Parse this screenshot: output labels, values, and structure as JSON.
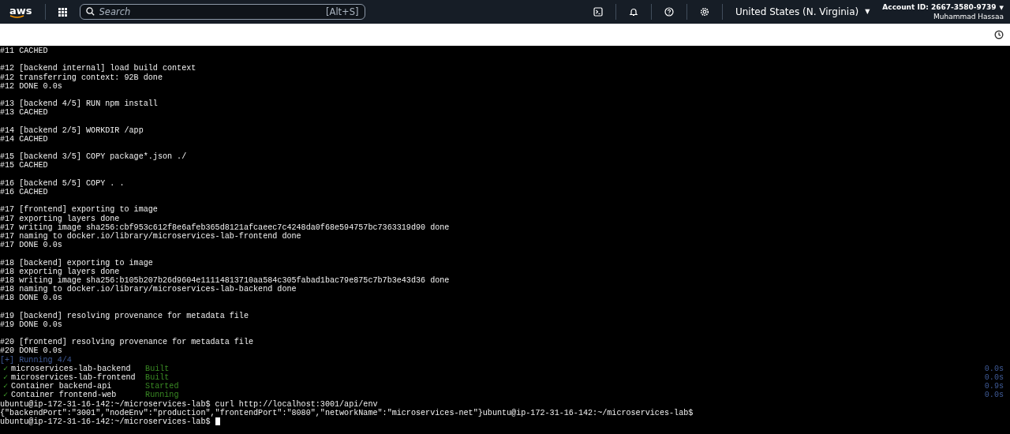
{
  "header": {
    "logo": "aws",
    "search": {
      "placeholder": "Search",
      "shortcut": "[Alt+S]"
    },
    "region": "United States (N. Virginia)",
    "region_caret": "▼",
    "account": "Account ID: 2667-3580-9739",
    "account_caret": "▼",
    "user": "Muhammad Hassaa"
  },
  "terminal": {
    "lines": [
      {
        "kind": "text",
        "text": "#11 CACHED"
      },
      {
        "kind": "blank"
      },
      {
        "kind": "text",
        "text": "#12 [backend internal] load build context"
      },
      {
        "kind": "text",
        "text": "#12 transferring context: 92B done"
      },
      {
        "kind": "text",
        "text": "#12 DONE 0.0s"
      },
      {
        "kind": "blank"
      },
      {
        "kind": "text",
        "text": "#13 [backend 4/5] RUN npm install"
      },
      {
        "kind": "text",
        "text": "#13 CACHED"
      },
      {
        "kind": "blank"
      },
      {
        "kind": "text",
        "text": "#14 [backend 2/5] WORKDIR /app"
      },
      {
        "kind": "text",
        "text": "#14 CACHED"
      },
      {
        "kind": "blank"
      },
      {
        "kind": "text",
        "text": "#15 [backend 3/5] COPY package*.json ./"
      },
      {
        "kind": "text",
        "text": "#15 CACHED"
      },
      {
        "kind": "blank"
      },
      {
        "kind": "text",
        "text": "#16 [backend 5/5] COPY . ."
      },
      {
        "kind": "text",
        "text": "#16 CACHED"
      },
      {
        "kind": "blank"
      },
      {
        "kind": "text",
        "text": "#17 [frontend] exporting to image"
      },
      {
        "kind": "text",
        "text": "#17 exporting layers done"
      },
      {
        "kind": "text",
        "text": "#17 writing image sha256:cbf953c612f8e6afeb365d8121afcaeec7c4248da0f68e594757bc7363319d90 done"
      },
      {
        "kind": "text",
        "text": "#17 naming to docker.io/library/microservices-lab-frontend done"
      },
      {
        "kind": "text",
        "text": "#17 DONE 0.0s"
      },
      {
        "kind": "blank"
      },
      {
        "kind": "text",
        "text": "#18 [backend] exporting to image"
      },
      {
        "kind": "text",
        "text": "#18 exporting layers done"
      },
      {
        "kind": "text",
        "text": "#18 writing image sha256:b105b207b26d9604e11114813710aa584c305fabad1bac79e875c7b7b3e43d36 done"
      },
      {
        "kind": "text",
        "text": "#18 naming to docker.io/library/microservices-lab-backend done"
      },
      {
        "kind": "text",
        "text": "#18 DONE 0.0s"
      },
      {
        "kind": "blank"
      },
      {
        "kind": "text",
        "text": "#19 [backend] resolving provenance for metadata file"
      },
      {
        "kind": "text",
        "text": "#19 DONE 0.0s"
      },
      {
        "kind": "blank"
      },
      {
        "kind": "text",
        "text": "#20 [frontend] resolving provenance for metadata file"
      },
      {
        "kind": "text",
        "text": "#20 DONE 0.0s"
      },
      {
        "kind": "status",
        "text": "[+] Running 4/4"
      },
      {
        "kind": "check",
        "mark": "✓",
        "name": "microservices-lab-backend",
        "state": "Built",
        "time": "0.0s"
      },
      {
        "kind": "check",
        "mark": "✓",
        "name": "microservices-lab-frontend",
        "state": "Built",
        "time": "0.0s"
      },
      {
        "kind": "check",
        "mark": "✓",
        "name": "Container backend-api",
        "state": "Started",
        "time": "0.9s"
      },
      {
        "kind": "check",
        "mark": "✓",
        "name": "Container frontend-web",
        "state": "Running",
        "time": "0.0s"
      },
      {
        "kind": "prompt",
        "text": "ubuntu@ip-172-31-16-142:~/microservices-lab$ curl http://localhost:3001/api/env"
      },
      {
        "kind": "text",
        "text": "{\"backendPort\":\"3001\",\"nodeEnv\":\"production\",\"frontendPort\":\"8080\",\"networkName\":\"microservices-net\"}ubuntu@ip-172-31-16-142:~/microservices-lab$"
      },
      {
        "kind": "prompt",
        "text": "ubuntu@ip-172-31-16-142:~/microservices-lab$",
        "cursor": true
      }
    ]
  }
}
